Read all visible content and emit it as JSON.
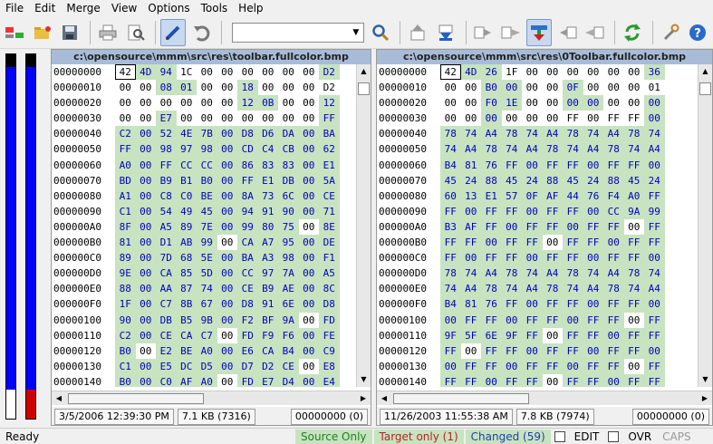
{
  "menu": [
    "File",
    "Edit",
    "Merge",
    "View",
    "Options",
    "Tools",
    "Help"
  ],
  "toolbar": {
    "find_value": "",
    "icons": [
      "save-icon",
      "print-icon",
      "print-preview-icon",
      "edit-icon",
      "undo-icon",
      "search-icon",
      "prev-diff-icon",
      "next-diff-icon",
      "current-diff-icon",
      "copy-to-right-icon",
      "copy-to-left-icon",
      "copy-right-advance-icon",
      "copy-left-advance-icon",
      "refresh-icon",
      "options-icon",
      "help-icon"
    ]
  },
  "left": {
    "path": "c:\\opensource\\mmm\\src\\res\\toolbar.fullcolor.bmp",
    "date": "3/5/2006  12:39:30 PM",
    "size": "7.1 KB (7316)",
    "position": "00000000 (0)",
    "rows": [
      {
        "off": "00000000",
        "bytes": "42 4D 94 1C 00 00 00 00 00 00 D2",
        "mask": "sddsssssssd"
      },
      {
        "off": "00000010",
        "bytes": "00 00 08 01 00 00 18 00 00 00 D2",
        "mask": "ssddssdssss"
      },
      {
        "off": "00000020",
        "bytes": "00 00 00 00 00 00 12 0B 00 00 12",
        "mask": "ssssssddssd"
      },
      {
        "off": "00000030",
        "bytes": "00 00 E7 00 00 00 00 00 00 00 FF",
        "mask": "ssdsssssssd"
      },
      {
        "off": "00000040",
        "bytes": "C2 00 52 4E 7B 00 D8 D6 DA 00 BA",
        "mask": "ddddddddddd"
      },
      {
        "off": "00000050",
        "bytes": "FF 00 98 97 98 00 CD C4 CB 00 62",
        "mask": "ddddddddddd"
      },
      {
        "off": "00000060",
        "bytes": "A0 00 FF CC CC 00 86 83 83 00 E1",
        "mask": "ddddddddddd"
      },
      {
        "off": "00000070",
        "bytes": "BD 00 B9 B1 B0 00 FF E1 DB 00 5A",
        "mask": "ddddddddddd"
      },
      {
        "off": "00000080",
        "bytes": "A1 00 C8 C0 BE 00 8A 73 6C 00 CE",
        "mask": "ddddddddddd"
      },
      {
        "off": "00000090",
        "bytes": "C1 00 54 49 45 00 94 91 90 00 71",
        "mask": "ddddddddddd"
      },
      {
        "off": "000000A0",
        "bytes": "8F 00 A5 89 7E 00 99 80 75 00 8E",
        "mask": "dddddddddsd"
      },
      {
        "off": "000000B0",
        "bytes": "81 00 D1 AB 99 00 CA A7 95 00 DE",
        "mask": "dddddsddddd"
      },
      {
        "off": "000000C0",
        "bytes": "89 00 7D 68 5E 00 BA A3 98 00 F1",
        "mask": "ddddddddddd"
      },
      {
        "off": "000000D0",
        "bytes": "9E 00 CA 85 5D 00 CC 97 7A 00 A5",
        "mask": "ddddddddddd"
      },
      {
        "off": "000000E0",
        "bytes": "88 00 AA 87 74 00 CE B9 AE 00 8C",
        "mask": "ddddddddddd"
      },
      {
        "off": "000000F0",
        "bytes": "1F 00 C7 8B 67 00 D8 91 6E 00 D8",
        "mask": "ddddddddddd"
      },
      {
        "off": "00000100",
        "bytes": "90 00 DB B5 9B 00 F2 BF 9A 00 FD",
        "mask": "dddddddddsd"
      },
      {
        "off": "00000110",
        "bytes": "C2 00 CE CA C7 00 FD F9 F6 00 FE",
        "mask": "dddddsddddd"
      },
      {
        "off": "00000120",
        "bytes": "B0 00 E2 BE A0 00 E6 CA B4 00 C9",
        "mask": "dsddddddddd"
      },
      {
        "off": "00000130",
        "bytes": "C1 00 E5 DC D5 00 D7 D2 CE 00 E8",
        "mask": "dddddddddsd"
      },
      {
        "off": "00000140",
        "bytes": "B0 00 C0 AF A0 00 FD E7 D4 00 E4",
        "mask": "dddddsddddd"
      }
    ]
  },
  "right": {
    "path": "c:\\opensource\\mmm\\src\\res\\0Toolbar.fullcolor.bmp",
    "date": "11/26/2003  11:55:38 AM",
    "size": "7.8 KB (7974)",
    "position": "00000000 (0)",
    "rows": [
      {
        "off": "00000000",
        "bytes": "42 4D 26 1F 00 00 00 00 00 00 36",
        "mask": "sddsssssssd"
      },
      {
        "off": "00000010",
        "bytes": "00 00 B0 00 00 00 0F 00 00 00 01",
        "mask": "ssddssdssss"
      },
      {
        "off": "00000020",
        "bytes": "00 00 F0 1E 00 00 00 00 00 00 00",
        "mask": "ssddssddssd"
      },
      {
        "off": "00000030",
        "bytes": "00 00 00 00 00 00 FF 00 FF FF 00",
        "mask": "ssdsssssssd"
      },
      {
        "off": "00000040",
        "bytes": "78 74 A4 78 74 A4 78 74 A4 78 74",
        "mask": "ddddddddddd"
      },
      {
        "off": "00000050",
        "bytes": "74 A4 78 74 A4 78 74 A4 78 74 A4",
        "mask": "ddddddddddd"
      },
      {
        "off": "00000060",
        "bytes": "B4 81 76 FF 00 FF FF 00 FF FF 00",
        "mask": "ddddddddddd"
      },
      {
        "off": "00000070",
        "bytes": "45 24 88 45 24 88 45 24 88 45 24",
        "mask": "ddddddddddd"
      },
      {
        "off": "00000080",
        "bytes": "60 13 E1 57 0F AF 44 76 F4 A0 FF",
        "mask": "ddddddddddd"
      },
      {
        "off": "00000090",
        "bytes": "FF 00 FF FF 00 FF FF 00 CC 9A 99",
        "mask": "ddddddddddd"
      },
      {
        "off": "000000A0",
        "bytes": "B3 AF FF 00 FF FF 00 FF FF 00 FF",
        "mask": "dddddddddsd"
      },
      {
        "off": "000000B0",
        "bytes": "FF FF 00 FF FF 00 FF FF 00 FF FF",
        "mask": "dddddsddddd"
      },
      {
        "off": "000000C0",
        "bytes": "FF 00 FF FF 00 FF FF 00 FF FF 00",
        "mask": "ddddddddddd"
      },
      {
        "off": "000000D0",
        "bytes": "78 74 A4 78 74 A4 78 74 A4 78 74",
        "mask": "ddddddddddd"
      },
      {
        "off": "000000E0",
        "bytes": "74 A4 78 74 A4 78 74 A4 78 74 A4",
        "mask": "ddddddddddd"
      },
      {
        "off": "000000F0",
        "bytes": "B4 81 76 FF 00 FF FF 00 FF FF 00",
        "mask": "ddddddddddd"
      },
      {
        "off": "00000100",
        "bytes": "00 FF FF 00 FF FF 00 FF FF 00 FF",
        "mask": "dddddddddsd"
      },
      {
        "off": "00000110",
        "bytes": "9F 5F 6E 9F FF 00 FF FF 00 FF FF",
        "mask": "dddddsddddd"
      },
      {
        "off": "00000120",
        "bytes": "FF 00 FF FF 00 FF FF 00 FF FF 00",
        "mask": "dsddddddddd"
      },
      {
        "off": "00000130",
        "bytes": "00 FF FF 00 FF FF 00 FF FF 00 FF",
        "mask": "dddddddddsd"
      },
      {
        "off": "00000140",
        "bytes": "FF FF 00 FF FF 00 FF FF 00 FF FF",
        "mask": "dddddsddddd"
      }
    ]
  },
  "status": {
    "ready": "Ready",
    "source_only": "Source Only",
    "target_only": "Target only (1)",
    "changed": "Changed (59)",
    "edit": "EDIT",
    "ovr": "OVR",
    "caps": "CAPS"
  },
  "colors": {
    "diff_bg": "#c7e3c0",
    "diff_fg": "#0000c0",
    "pane_title_bg": "#a8bcd8",
    "locator_blue": "#0000ff",
    "locator_red": "#d00000"
  }
}
